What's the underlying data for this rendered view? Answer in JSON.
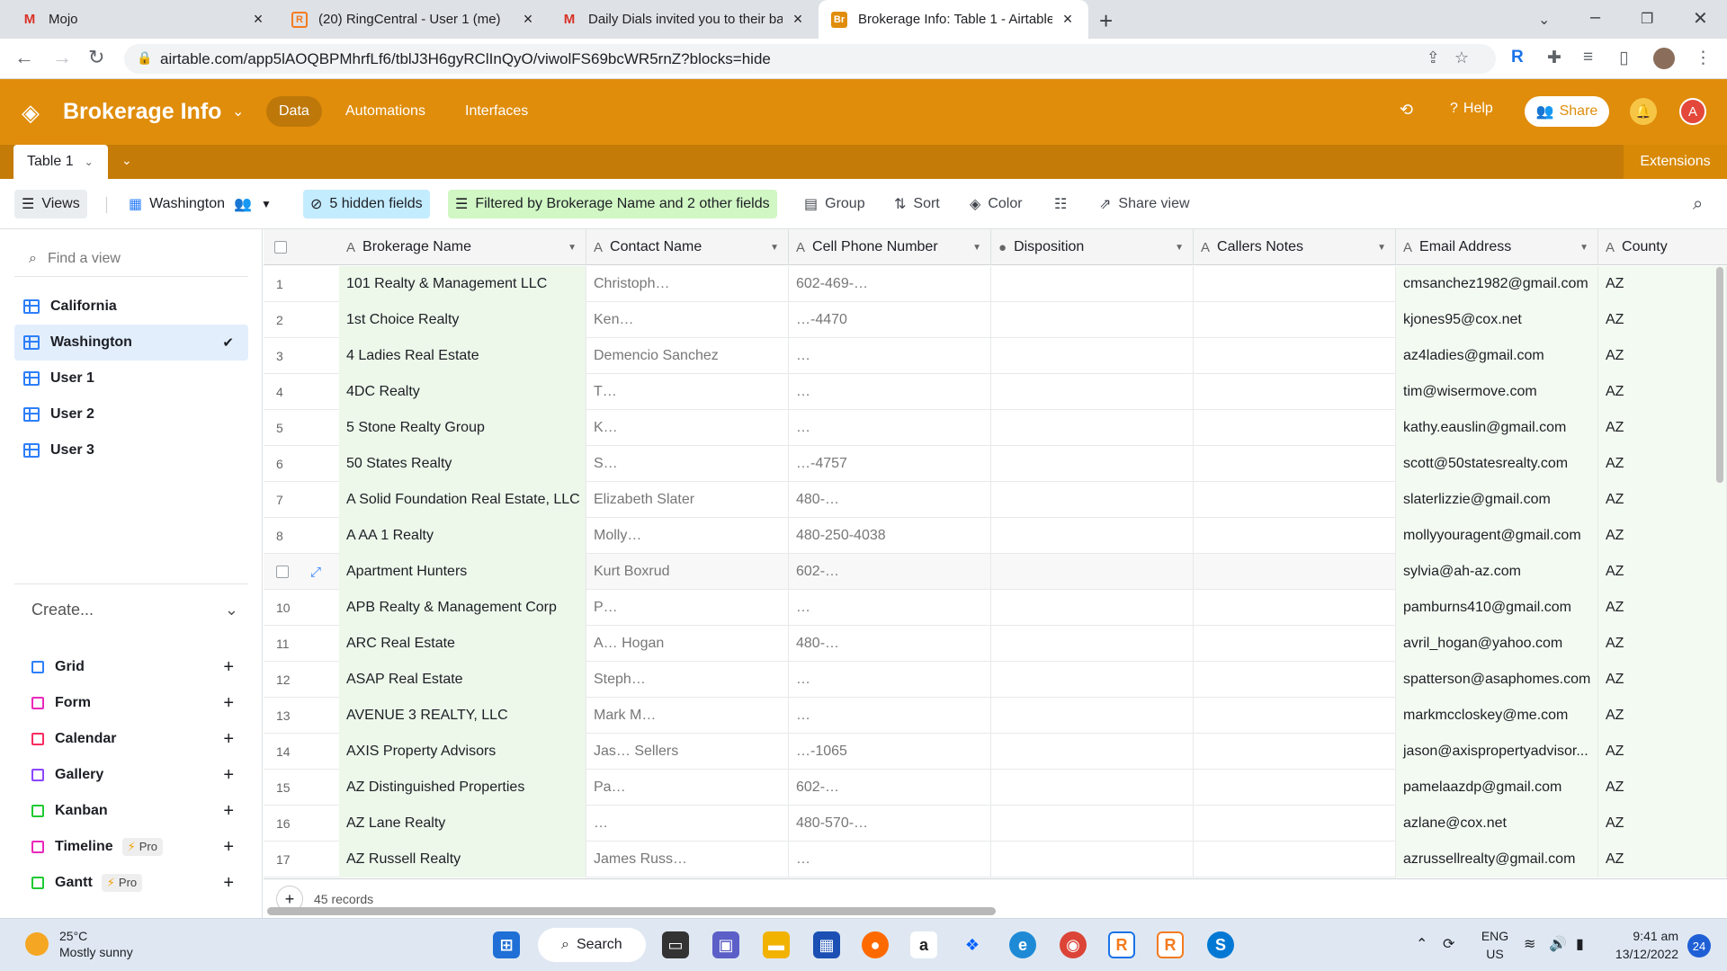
{
  "browser": {
    "tabs": [
      {
        "title": "Mojo",
        "favicon": "gmail-icon",
        "active": false
      },
      {
        "title": "(20) RingCentral - User 1 (me)",
        "favicon": "ringcentral-icon",
        "active": false
      },
      {
        "title": "Daily Dials invited you to their ba",
        "favicon": "gmail-icon",
        "active": false
      },
      {
        "title": "Brokerage Info: Table 1 - Airtable",
        "favicon": "airtable-icon",
        "active": true
      }
    ],
    "url": "airtable.com/app5lAOQBPMhrfLf6/tblJ3H6gyRClInQyO/viwolFS69bcWR5rnZ?blocks=hide"
  },
  "app": {
    "base_name": "Brokerage Info",
    "nav": [
      "Data",
      "Automations",
      "Interfaces"
    ],
    "help": "Help",
    "share": "Share",
    "avatar_initial": "A",
    "accent": "#e08d0b"
  },
  "tablebar": {
    "table_name": "Table 1",
    "extensions": "Extensions"
  },
  "viewbar": {
    "views": "Views",
    "current_view": "Washington",
    "hidden_fields": "5 hidden fields",
    "filter": "Filtered by Brokerage Name and 2 other fields",
    "group": "Group",
    "sort": "Sort",
    "color": "Color",
    "share_view": "Share view"
  },
  "sidebar": {
    "find_placeholder": "Find a view",
    "views": [
      "California",
      "Washington",
      "User 1",
      "User 2",
      "User 3"
    ],
    "selected_view": "Washington",
    "create_label": "Create...",
    "create_items": [
      {
        "label": "Grid",
        "color": "#2d7ff9",
        "pro": ""
      },
      {
        "label": "Form",
        "color": "#e929ba",
        "pro": ""
      },
      {
        "label": "Calendar",
        "color": "#f82b60",
        "pro": ""
      },
      {
        "label": "Gallery",
        "color": "#8b46ff",
        "pro": ""
      },
      {
        "label": "Kanban",
        "color": "#20c933",
        "pro": ""
      },
      {
        "label": "Timeline",
        "color": "#e929ba",
        "pro": "Pro"
      },
      {
        "label": "Gantt",
        "color": "#20c933",
        "pro": "Pro"
      }
    ]
  },
  "grid": {
    "columns": [
      "Brokerage Name",
      "Contact Name",
      "Cell Phone Number",
      "Disposition",
      "Callers Notes",
      "Email Address",
      "County"
    ],
    "rows": [
      {
        "n": "1",
        "brokerage": "101 Realty & Management LLC",
        "contact": "Christoph…",
        "phone": "602-469-…",
        "email": "cmsanchez1982@gmail.com",
        "county": "AZ"
      },
      {
        "n": "2",
        "brokerage": "1st Choice Realty",
        "contact": "Ken…",
        "phone": "…-4470",
        "email": "kjones95@cox.net",
        "county": "AZ"
      },
      {
        "n": "3",
        "brokerage": "4 Ladies Real Estate",
        "contact": "Demencio Sanchez",
        "phone": "…",
        "email": "az4ladies@gmail.com",
        "county": "AZ"
      },
      {
        "n": "4",
        "brokerage": "4DC Realty",
        "contact": "T…",
        "phone": "…",
        "email": "tim@wisermove.com",
        "county": "AZ"
      },
      {
        "n": "5",
        "brokerage": "5 Stone Realty Group",
        "contact": "K…",
        "phone": "…",
        "email": "kathy.eauslin@gmail.com",
        "county": "AZ"
      },
      {
        "n": "6",
        "brokerage": "50 States Realty",
        "contact": "S…",
        "phone": "…-4757",
        "email": "scott@50statesrealty.com",
        "county": "AZ"
      },
      {
        "n": "7",
        "brokerage": "A Solid Foundation Real Estate, LLC",
        "contact": "Elizabeth Slater",
        "phone": "480-…",
        "email": "slaterlizzie@gmail.com",
        "county": "AZ"
      },
      {
        "n": "8",
        "brokerage": "A AA 1 Realty",
        "contact": "Molly…",
        "phone": "480-250-4038",
        "email": "mollyyouragent@gmail.com",
        "county": "AZ"
      },
      {
        "n": "",
        "brokerage": "Apartment Hunters",
        "contact": "Kurt Boxrud",
        "phone": "602-…",
        "email": "sylvia@ah-az.com",
        "county": "AZ"
      },
      {
        "n": "10",
        "brokerage": "APB Realty & Management Corp",
        "contact": "P…",
        "phone": "…",
        "email": "pamburns410@gmail.com",
        "county": "AZ"
      },
      {
        "n": "11",
        "brokerage": "ARC Real Estate",
        "contact": "A… Hogan",
        "phone": "480-…",
        "email": "avril_hogan@yahoo.com",
        "county": "AZ"
      },
      {
        "n": "12",
        "brokerage": "ASAP Real Estate",
        "contact": "Steph…",
        "phone": "…",
        "email": "spatterson@asaphomes.com",
        "county": "AZ"
      },
      {
        "n": "13",
        "brokerage": "AVENUE 3 REALTY, LLC",
        "contact": "Mark M…",
        "phone": "…",
        "email": "markmccloskey@me.com",
        "county": "AZ"
      },
      {
        "n": "14",
        "brokerage": "AXIS Property Advisors",
        "contact": "Jas… Sellers",
        "phone": "…-1065",
        "email": "jason@axispropertyadvisor...",
        "county": "AZ"
      },
      {
        "n": "15",
        "brokerage": "AZ Distinguished Properties",
        "contact": "Pa…",
        "phone": "602-…",
        "email": "pamelaazdp@gmail.com",
        "county": "AZ"
      },
      {
        "n": "16",
        "brokerage": "AZ Lane Realty",
        "contact": "…",
        "phone": "480-570-…",
        "email": "azlane@cox.net",
        "county": "AZ"
      },
      {
        "n": "17",
        "brokerage": "AZ Russell Realty",
        "contact": "James Russ…",
        "phone": "…",
        "email": "azrussellrealty@gmail.com",
        "county": "AZ"
      }
    ],
    "records": "45 records"
  },
  "taskbar": {
    "temp": "25°C",
    "weather": "Mostly sunny",
    "search": "Search",
    "lang1": "ENG",
    "lang2": "US",
    "time": "9:41 am",
    "date": "13/12/2022",
    "notif_count": "24"
  }
}
